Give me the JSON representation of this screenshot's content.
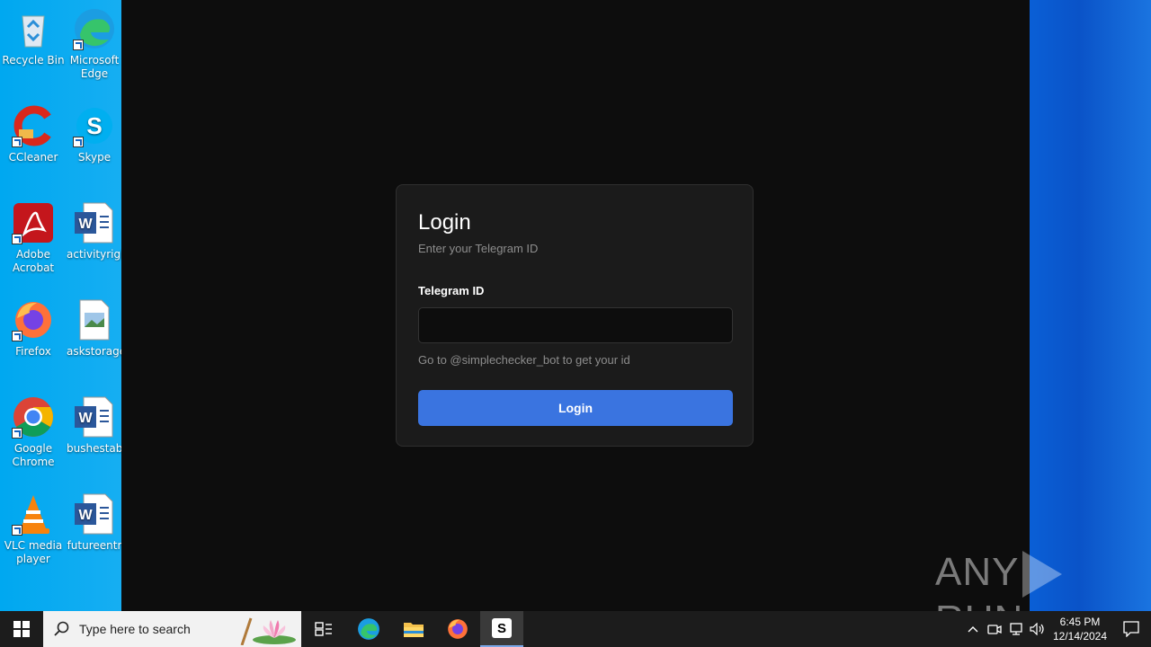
{
  "desktop": {
    "icons": [
      {
        "label": "Recycle Bin",
        "icon": "recycle-bin-icon"
      },
      {
        "label": "Microsoft Edge",
        "icon": "edge-icon"
      },
      {
        "label": "CCleaner",
        "icon": "ccleaner-icon"
      },
      {
        "label": "Skype",
        "icon": "skype-icon"
      },
      {
        "label": "Adobe Acrobat",
        "icon": "acrobat-icon"
      },
      {
        "label": "activityrigh",
        "icon": "word-doc-icon"
      },
      {
        "label": "Firefox",
        "icon": "firefox-icon"
      },
      {
        "label": "askstorage.",
        "icon": "image-file-icon"
      },
      {
        "label": "Google Chrome",
        "icon": "chrome-icon"
      },
      {
        "label": "bushestab",
        "icon": "word-doc-icon"
      },
      {
        "label": "VLC media player",
        "icon": "vlc-icon"
      },
      {
        "label": "futureentr",
        "icon": "word-doc-icon"
      }
    ]
  },
  "login": {
    "title": "Login",
    "subtitle": "Enter your Telegram ID",
    "field_label": "Telegram ID",
    "input_value": "",
    "hint": "Go to @simplechecker_bot to get your id",
    "button_label": "Login"
  },
  "watermark": {
    "left": "ANY",
    "right": "RUN"
  },
  "taskbar": {
    "search_placeholder": "Type here to search",
    "time": "6:45 PM",
    "date": "12/14/2024",
    "active_app_letter": "S"
  },
  "colors": {
    "accent": "#3a74e0",
    "card_bg": "#1b1b1b",
    "window_bg": "#0d0d0d"
  }
}
